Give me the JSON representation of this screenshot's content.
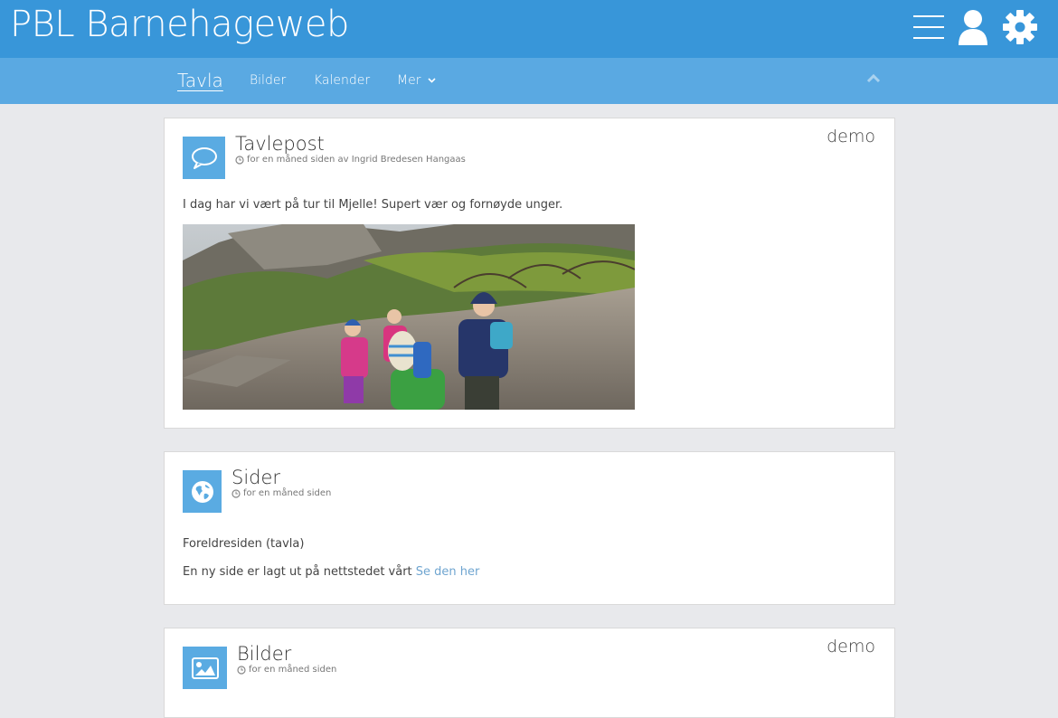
{
  "app": {
    "title": "PBL Barnehageweb"
  },
  "header_icons": [
    "menu-icon",
    "user-icon",
    "gear-icon"
  ],
  "nav": {
    "items": [
      {
        "label": "Tavla",
        "active": true
      },
      {
        "label": "Bilder",
        "active": false
      },
      {
        "label": "Kalender",
        "active": false
      },
      {
        "label": "Mer",
        "active": false,
        "has_dropdown": true
      }
    ]
  },
  "posts": [
    {
      "type_icon": "speech-bubble-icon",
      "title": "Tavlepost",
      "meta": "for en måned siden av Ingrid Bredesen Hangaas",
      "owner": "demo",
      "text": "I dag har vi vært på tur til Mjelle! Supert vær og fornøyde unger.",
      "image": "children-hiking-photo"
    },
    {
      "type_icon": "globe-icon",
      "title": "Sider",
      "meta": "for en måned siden",
      "line1": "Foreldresiden (tavla)",
      "line2": "En ny side er lagt ut på nettstedet vårt",
      "link_label": "Se den her"
    },
    {
      "type_icon": "picture-icon",
      "title": "Bilder",
      "meta": "for en måned siden",
      "owner": "demo"
    }
  ],
  "colors": {
    "topbar": "#3896d9",
    "subnav": "#5aa9e2",
    "icon_tile": "#5aabe2",
    "link": "#6fa5d0",
    "background": "#e8e9ec"
  }
}
